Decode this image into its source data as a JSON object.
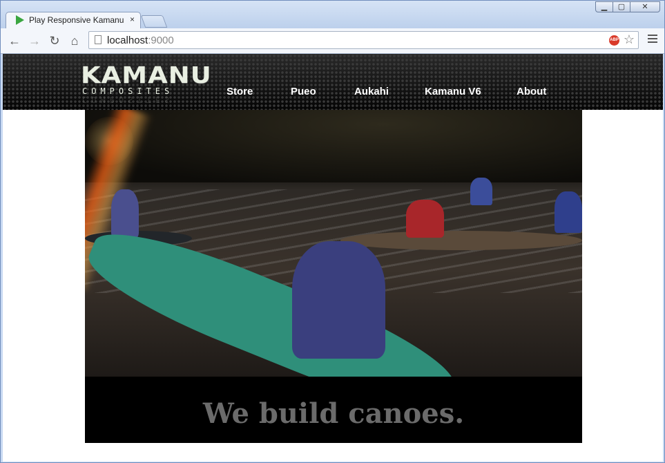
{
  "browser": {
    "tab_title": "Play Responsive Kamanu",
    "tab_close": "×",
    "url_host": "localhost",
    "url_port": ":9000",
    "adblock_label": "ABP"
  },
  "site": {
    "logo_word": "KAMANU",
    "logo_sub": "COMPOSITES",
    "nav": [
      "Store",
      "Pueo",
      "Aukahi",
      "Kamanu V6",
      "About"
    ],
    "tagline": "We build canoes."
  }
}
